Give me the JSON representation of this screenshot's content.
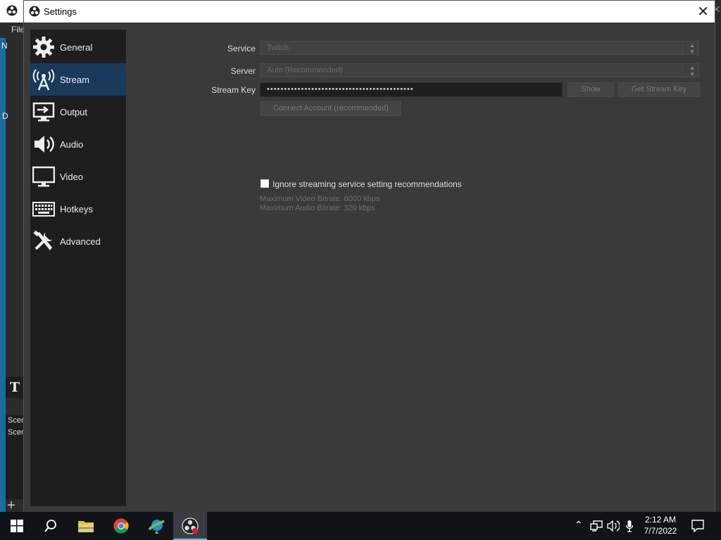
{
  "background_window": {
    "menu_first_label": "File",
    "side_letters": [
      "N",
      "D"
    ],
    "scenes_partial": [
      "Scene",
      "Scene"
    ]
  },
  "dialog": {
    "title": "Settings",
    "close_icon": "close-icon"
  },
  "sidebar": {
    "items": [
      {
        "label": "General",
        "icon": "gear-icon",
        "active": false
      },
      {
        "label": "Stream",
        "icon": "broadcast-tower-icon",
        "active": true
      },
      {
        "label": "Output",
        "icon": "output-monitor-icon",
        "active": false
      },
      {
        "label": "Audio",
        "icon": "speaker-icon",
        "active": false
      },
      {
        "label": "Video",
        "icon": "monitor-icon",
        "active": false
      },
      {
        "label": "Hotkeys",
        "icon": "keyboard-icon",
        "active": false
      },
      {
        "label": "Advanced",
        "icon": "tools-icon",
        "active": false
      }
    ]
  },
  "stream": {
    "service_label": "Service",
    "service_value": "Twitch",
    "server_label": "Server",
    "server_value": "Auto (Recommended)",
    "stream_key_label": "Stream Key",
    "stream_key_value": "•••••••••••••••••••••••••••••••••••••••••••",
    "show_button": "Show",
    "get_key_button": "Get Stream Key",
    "connect_button": "Connect Account (recommended)",
    "ignore_checkbox_label": "Ignore streaming service setting recommendations",
    "ignore_checked": false,
    "max_video_bitrate": "Maximum Video Bitrate: 6000 kbps",
    "max_audio_bitrate": "Maximum Audio Bitrate: 320 kbps"
  },
  "taskbar": {
    "apps": [
      "start-icon",
      "search-icon",
      "file-explorer-icon",
      "chrome-icon",
      "download-manager-icon",
      "obs-icon"
    ],
    "tray_icons": [
      "chevron-up-icon",
      "network-icon",
      "volume-icon",
      "microphone-icon"
    ],
    "time": "2:12 AM",
    "date": "7/7/2022",
    "notification_icon": "notification-icon"
  },
  "colors": {
    "dialog_bg": "#3a3a3a",
    "sidebar_bg": "#1e1e1e",
    "active_item": "#1a3a5c",
    "taskbar_bg": "#101418"
  }
}
